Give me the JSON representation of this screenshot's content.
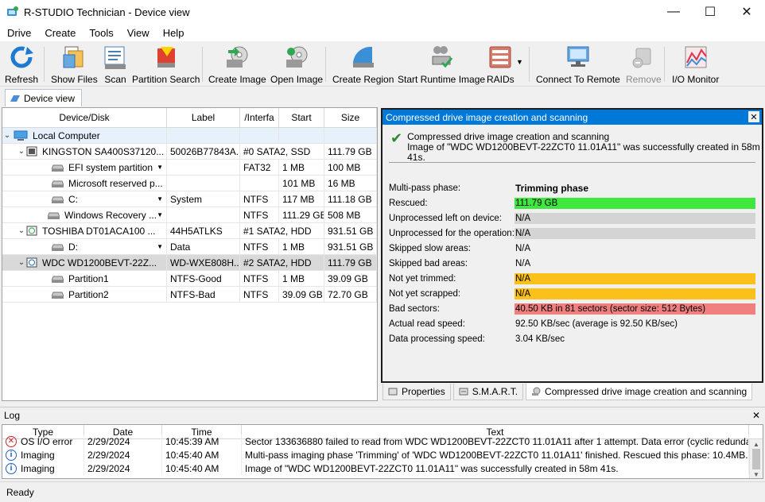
{
  "window": {
    "title": "R-STUDIO Technician - Device view"
  },
  "menu": [
    "Drive",
    "Create",
    "Tools",
    "View",
    "Help"
  ],
  "toolbar": {
    "refresh": "Refresh",
    "show_files": "Show Files",
    "scan": "Scan",
    "partition_search": "Partition Search",
    "create_image": "Create Image",
    "open_image": "Open Image",
    "create_region": "Create Region",
    "start_runtime_image": "Start Runtime Image",
    "raids": "RAIDs",
    "connect_remote": "Connect To Remote",
    "remove": "Remove",
    "io_monitor": "I/O Monitor"
  },
  "tabs": {
    "device_view": "Device view"
  },
  "tree": {
    "columns": [
      "Device/Disk",
      "Label",
      "/Interfa",
      "Start",
      "Size"
    ],
    "rows": [
      {
        "name": "Local Computer",
        "label": "",
        "iface": "",
        "start": "",
        "size": ""
      },
      {
        "name": "KINGSTON SA400S37120...",
        "label": "50026B77843A...",
        "iface": "#0 SATA2, SSD",
        "start": "",
        "size": "111.79 GB"
      },
      {
        "name": "EFI system partition",
        "label": "",
        "iface": "FAT32",
        "start": "1 MB",
        "size": "100 MB"
      },
      {
        "name": "Microsoft reserved p...",
        "label": "",
        "iface": "",
        "start": "101 MB",
        "size": "16 MB"
      },
      {
        "name": "C:",
        "label": "System",
        "iface": "NTFS",
        "start": "117 MB",
        "size": "111.18 GB"
      },
      {
        "name": "Windows Recovery ...",
        "label": "",
        "iface": "NTFS",
        "start": "111.29 GB",
        "size": "508 MB"
      },
      {
        "name": "TOSHIBA DT01ACA100 ...",
        "label": "44H5ATLKS",
        "iface": "#1 SATA2, HDD",
        "start": "",
        "size": "931.51 GB"
      },
      {
        "name": "D:",
        "label": "Data",
        "iface": "NTFS",
        "start": "1 MB",
        "size": "931.51 GB"
      },
      {
        "name": "WDC WD1200BEVT-22Z...",
        "label": "WD-WXE808H...",
        "iface": "#2 SATA2, HDD",
        "start": "",
        "size": "111.79 GB"
      },
      {
        "name": "Partition1",
        "label": "NTFS-Good",
        "iface": "NTFS",
        "start": "1 MB",
        "size": "39.09 GB"
      },
      {
        "name": "Partition2",
        "label": "NTFS-Bad",
        "iface": "NTFS",
        "start": "39.09 GB",
        "size": "72.70 GB"
      }
    ]
  },
  "panel": {
    "title": "Compressed drive image creation and scanning",
    "status_line1": "Compressed drive image creation and scanning",
    "status_line2": "Image of \"WDC WD1200BEVT-22ZCT0 11.01A11\" was successfully created in 58m 41s.",
    "rows": [
      {
        "key": "Multi-pass phase:",
        "value": "Trimming phase",
        "color": ""
      },
      {
        "key": "Rescued:",
        "value": "111.79 GB",
        "color": "#3ee83e"
      },
      {
        "key": "Unprocessed left on device:",
        "value": "N/A",
        "color": "#d4d4d4"
      },
      {
        "key": "Unprocessed for the operation:",
        "value": "N/A",
        "color": "#d4d4d4"
      },
      {
        "key": "Skipped slow areas:",
        "value": "N/A",
        "color": ""
      },
      {
        "key": "Skipped bad areas:",
        "value": "N/A",
        "color": ""
      },
      {
        "key": "Not yet trimmed:",
        "value": "N/A",
        "color": "#fcc01a"
      },
      {
        "key": "Not yet scrapped:",
        "value": "N/A",
        "color": "#fcc01a"
      },
      {
        "key": "Bad sectors:",
        "value": "40.50 KB in 81 sectors (sector size: 512 Bytes)",
        "color": "#f08080"
      },
      {
        "key": "Actual read speed:",
        "value": "92.50 KB/sec (average is 92.50 KB/sec)",
        "color": ""
      },
      {
        "key": "Data processing speed:",
        "value": "3.04 KB/sec",
        "color": ""
      }
    ],
    "tabs": [
      "Properties",
      "S.M.A.R.T.",
      "Compressed drive image creation and scanning"
    ]
  },
  "log": {
    "title": "Log",
    "columns": [
      "Type",
      "Date",
      "Time",
      "Text"
    ],
    "rows": [
      {
        "type": "OS I/O error",
        "date": "2/29/2024",
        "time": "10:45:39 AM",
        "text": "Sector 133636880 failed to read from WDC WD1200BEVT-22ZCT0 11.01A11 after 1 attempt. Data error (cyclic redundan..."
      },
      {
        "type": "Imaging",
        "date": "2/29/2024",
        "time": "10:45:40 AM",
        "text": "Multi-pass imaging phase 'Trimming' of 'WDC WD1200BEVT-22ZCT0 11.01A11' finished. Rescued this phase: 10.4MB. T..."
      },
      {
        "type": "Imaging",
        "date": "2/29/2024",
        "time": "10:45:40 AM",
        "text": "Image of \"WDC WD1200BEVT-22ZCT0 11.01A11\" was successfully created in 58m 41s."
      }
    ]
  },
  "status": {
    "text": "Ready"
  }
}
